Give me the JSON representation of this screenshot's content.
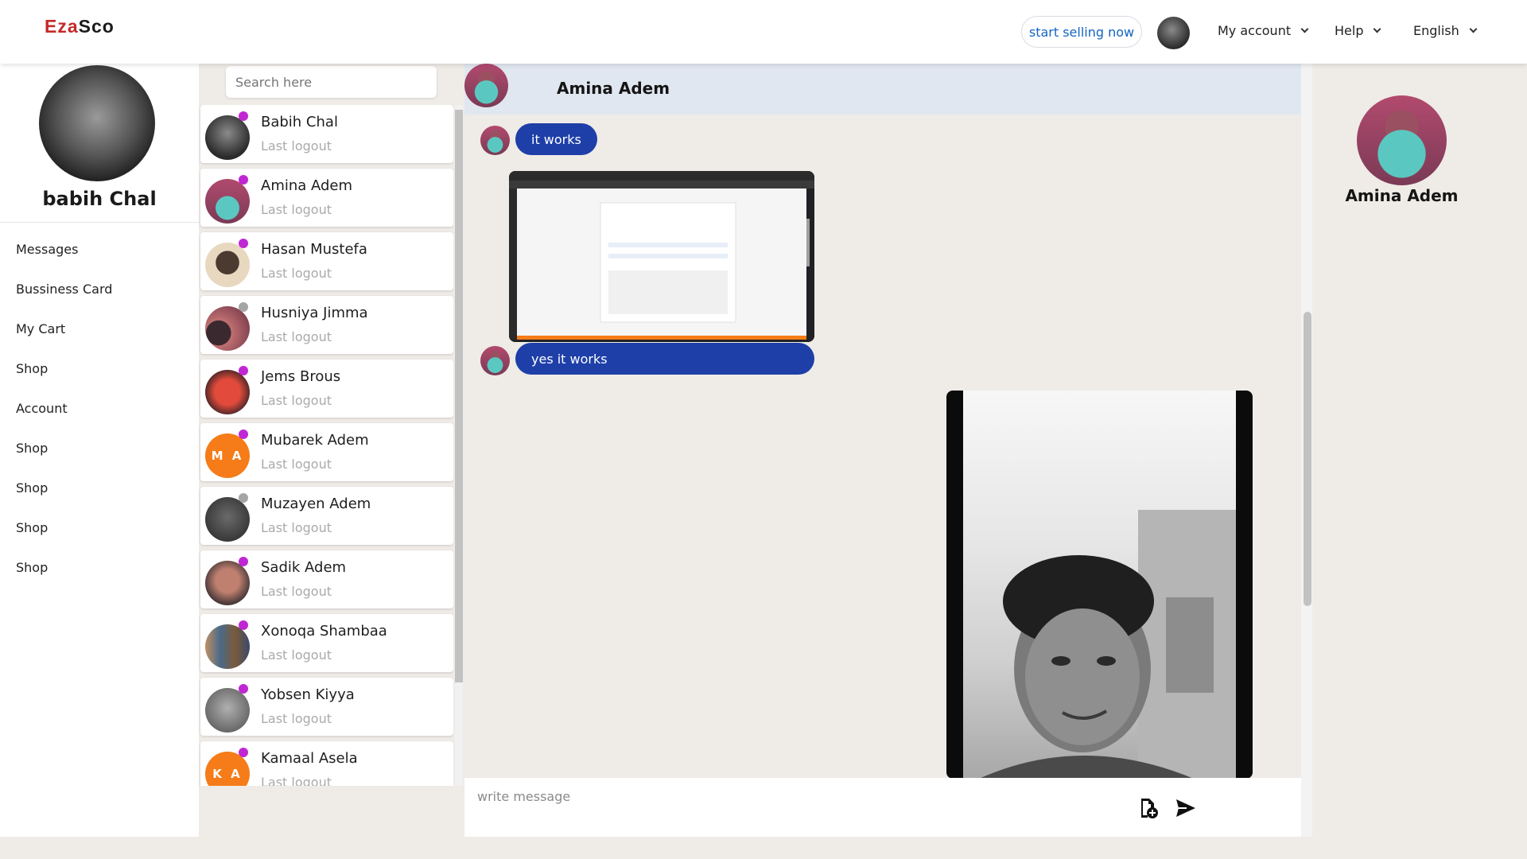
{
  "header": {
    "logo_part1": "Eza",
    "logo_part2": "Sco",
    "sell_button": "start selling now",
    "menu": [
      {
        "label": "My account"
      },
      {
        "label": "Help"
      },
      {
        "label": "English"
      }
    ]
  },
  "profile": {
    "name": "babih Chal",
    "nav": [
      "Messages",
      "Bussiness Card",
      "My Cart",
      "Shop",
      "Account",
      "Shop",
      "Shop",
      "Shop",
      "Shop"
    ]
  },
  "search": {
    "placeholder": "Search here"
  },
  "contacts": [
    {
      "name": "Babih Chal",
      "status": "Last logout",
      "initials": "",
      "online": true
    },
    {
      "name": "Amina Adem",
      "status": "Last logout",
      "initials": "",
      "online": true
    },
    {
      "name": "Hasan Mustefa",
      "status": "Last logout",
      "initials": "",
      "online": true
    },
    {
      "name": "Husniya Jimma",
      "status": "Last logout",
      "initials": "",
      "online": false
    },
    {
      "name": "Jems Brous",
      "status": "Last logout",
      "initials": "",
      "online": true
    },
    {
      "name": "Mubarek Adem",
      "status": "Last logout",
      "initials": "M A",
      "online": true
    },
    {
      "name": "Muzayen Adem",
      "status": "Last logout",
      "initials": "",
      "online": false
    },
    {
      "name": "Sadik Adem",
      "status": "Last logout",
      "initials": "",
      "online": true
    },
    {
      "name": "Xonoqa Shambaa",
      "status": "Last logout",
      "initials": "",
      "online": true
    },
    {
      "name": "Yobsen Kiyya",
      "status": "Last logout",
      "initials": "",
      "online": true
    },
    {
      "name": "Kamaal Asela",
      "status": "Last logout",
      "initials": "K A",
      "online": true
    }
  ],
  "chat": {
    "contact_name": "Amina Adem",
    "messages": [
      {
        "text": "it works"
      },
      {
        "text": "yes it works"
      }
    ],
    "compose_placeholder": "write message"
  },
  "right_panel": {
    "name": "Amina Adem"
  },
  "colors": {
    "accent": "#1e3fa8",
    "online_dot": "#c026d3",
    "offline_dot": "#a5a5a5",
    "initials_avatar": "#f57c18",
    "logo_red": "#c62828"
  }
}
